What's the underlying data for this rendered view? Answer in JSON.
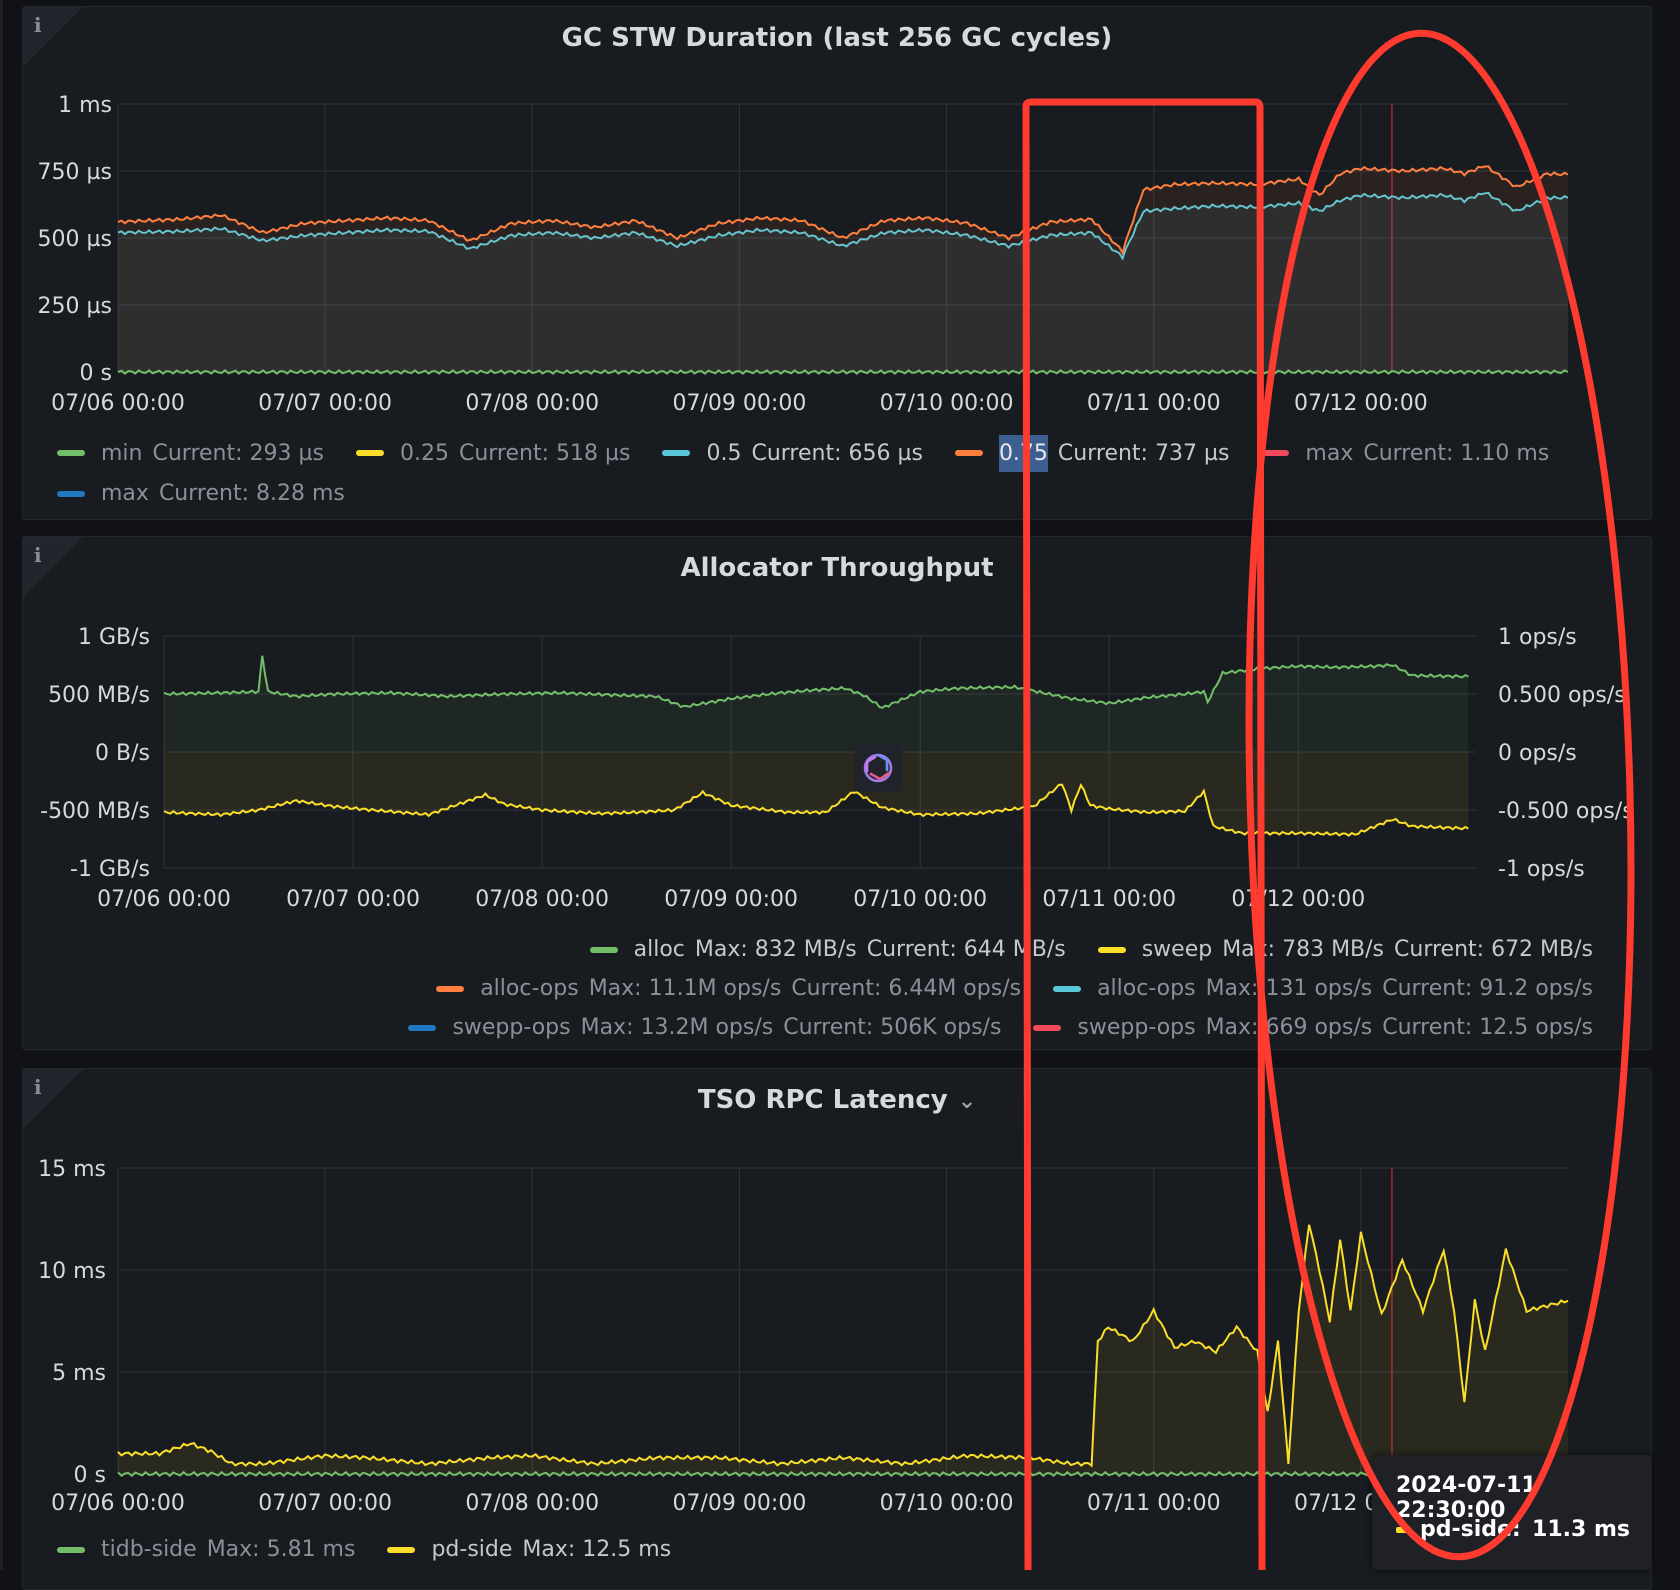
{
  "colors": {
    "green": "#73bf69",
    "yellow": "#fade2a",
    "cyan": "#5ac8d8",
    "orange": "#ff7f3e",
    "red": "#f2495c",
    "blue": "#1f78c1",
    "annotation_red": "#ff3b30"
  },
  "panels": [
    {
      "title": "GC STW Duration (last 256 GC cycles)",
      "has_dropdown": false,
      "legend": [
        [
          {
            "color": "green",
            "name": "min",
            "stats": [
              "Current: 293 µs"
            ],
            "dim": true
          },
          {
            "color": "yellow",
            "name": "0.25",
            "stats": [
              "Current: 518 µs"
            ],
            "dim": true
          },
          {
            "color": "cyan",
            "name": "0.5",
            "stats": [
              "Current: 656 µs"
            ],
            "dim": false
          },
          {
            "color": "orange",
            "name": "0.75",
            "stats": [
              "Current: 737 µs"
            ],
            "dim": false
          },
          {
            "color": "red",
            "name": "max",
            "stats": [
              "Current: 1.10 ms"
            ],
            "dim": true
          }
        ],
        [
          {
            "color": "blue",
            "name": "max",
            "stats": [
              "Current: 8.28 ms"
            ],
            "dim": true
          }
        ]
      ]
    },
    {
      "title": "Allocator Throughput",
      "has_dropdown": false,
      "legend": [
        [
          {
            "color": "green",
            "name": "alloc",
            "stats": [
              "Max: 832 MB/s",
              "Current: 644 MB/s"
            ],
            "dim": false
          },
          {
            "color": "yellow",
            "name": "sweep",
            "stats": [
              "Max: 783 MB/s",
              "Current: 672 MB/s"
            ],
            "dim": false
          }
        ],
        [
          {
            "color": "orange",
            "name": "alloc-ops",
            "stats": [
              "Max: 11.1M ops/s",
              "Current: 6.44M ops/s"
            ],
            "dim": true
          },
          {
            "color": "cyan",
            "name": "alloc-ops",
            "stats": [
              "Max: 131 ops/s",
              "Current: 91.2 ops/s"
            ],
            "dim": true
          }
        ],
        [
          {
            "color": "blue",
            "name": "swepp-ops",
            "stats": [
              "Max: 13.2M ops/s",
              "Current: 506K ops/s"
            ],
            "dim": true
          },
          {
            "color": "red",
            "name": "swepp-ops",
            "stats": [
              "Max: 669 ops/s",
              "Current: 12.5 ops/s"
            ],
            "dim": true
          }
        ]
      ]
    },
    {
      "title": "TSO RPC Latency",
      "has_dropdown": true,
      "legend": [
        [
          {
            "color": "green",
            "name": "tidb-side",
            "stats": [
              "Max: 5.81 ms"
            ],
            "dim": true
          },
          {
            "color": "yellow",
            "name": "pd-side",
            "stats": [
              "Max: 12.5 ms"
            ],
            "dim": false
          }
        ]
      ]
    }
  ],
  "tooltip": {
    "time": "2024-07-11 22:30:00",
    "series": "pd-side:",
    "value": "11.3 ms"
  },
  "chart_data": [
    {
      "type": "line",
      "title": "GC STW Duration (last 256 GC cycles)",
      "y_ticks": [
        "1 ms",
        "750 µs",
        "500 µs",
        "250 µs",
        "0 s"
      ],
      "ylim": [
        0,
        1000
      ],
      "y_unit": "µs",
      "x_ticks": [
        "07/06 00:00",
        "07/07 00:00",
        "07/08 00:00",
        "07/09 00:00",
        "07/10 00:00",
        "07/11 00:00",
        "07/12 00:00"
      ],
      "x_range": [
        "07/06 00:00",
        "07/13 00:00"
      ],
      "series": [
        {
          "name": "0.5",
          "color": "cyan",
          "x": [
            0,
            0.3,
            0.5,
            0.7,
            0.9,
            1.1,
            1.3,
            1.5,
            1.7,
            1.9,
            2.1,
            2.3,
            2.5,
            2.7,
            2.9,
            3.1,
            3.3,
            3.5,
            3.7,
            3.9,
            4.1,
            4.3,
            4.5,
            4.7,
            4.85,
            4.95,
            5.1,
            5.3,
            5.5,
            5.7,
            5.8,
            5.9,
            6.0,
            6.2,
            6.4,
            6.5,
            6.6,
            6.75,
            6.9,
            7.0
          ],
          "values": [
            520,
            525,
            535,
            490,
            510,
            520,
            530,
            525,
            460,
            510,
            520,
            500,
            520,
            470,
            510,
            530,
            520,
            470,
            520,
            530,
            510,
            470,
            510,
            520,
            430,
            600,
            610,
            620,
            615,
            630,
            600,
            640,
            660,
            650,
            660,
            640,
            670,
            600,
            650,
            650
          ]
        },
        {
          "name": "0.75",
          "color": "orange",
          "x": [
            0,
            0.3,
            0.5,
            0.7,
            0.9,
            1.1,
            1.3,
            1.5,
            1.7,
            1.9,
            2.1,
            2.3,
            2.5,
            2.7,
            2.9,
            3.1,
            3.3,
            3.5,
            3.7,
            3.9,
            4.1,
            4.3,
            4.5,
            4.7,
            4.85,
            4.95,
            5.1,
            5.3,
            5.5,
            5.7,
            5.8,
            5.9,
            6.0,
            6.2,
            6.4,
            6.5,
            6.6,
            6.75,
            6.9,
            7.0
          ],
          "values": [
            560,
            570,
            585,
            520,
            555,
            565,
            575,
            565,
            490,
            555,
            565,
            540,
            565,
            500,
            555,
            575,
            565,
            500,
            565,
            575,
            555,
            500,
            560,
            570,
            450,
            680,
            700,
            705,
            700,
            720,
            660,
            740,
            760,
            750,
            760,
            740,
            770,
            690,
            740,
            737
          ]
        },
        {
          "name": "min",
          "color": "green",
          "x": [
            0,
            7
          ],
          "values": [
            0,
            0
          ]
        }
      ]
    },
    {
      "type": "line",
      "title": "Allocator Throughput",
      "y_ticks": [
        "1 GB/s",
        "500 MB/s",
        "0 B/s",
        "-500 MB/s",
        "-1 GB/s"
      ],
      "y2_ticks": [
        "1 ops/s",
        "0.500 ops/s",
        "0 ops/s",
        "-0.500 ops/s",
        "-1 ops/s"
      ],
      "ylim": [
        -1000,
        1000
      ],
      "y_unit": "MB/s",
      "x_ticks": [
        "07/06 00:00",
        "07/07 00:00",
        "07/08 00:00",
        "07/09 00:00",
        "07/10 00:00",
        "07/11 00:00",
        "07/12 00:00"
      ],
      "x_range": [
        "07/06 00:00",
        "07/12 22:30"
      ],
      "series": [
        {
          "name": "alloc",
          "color": "green",
          "x": [
            0,
            0.3,
            0.5,
            0.52,
            0.55,
            0.7,
            0.9,
            1.2,
            1.5,
            1.8,
            2.1,
            2.4,
            2.6,
            2.75,
            3.0,
            3.2,
            3.4,
            3.6,
            3.7,
            3.8,
            4.0,
            4.2,
            4.5,
            4.8,
            5.0,
            5.2,
            5.4,
            5.5,
            5.52,
            5.6,
            5.8,
            6.0,
            6.2,
            6.4,
            6.5,
            6.6,
            6.9
          ],
          "values": [
            500,
            510,
            520,
            830,
            520,
            480,
            500,
            510,
            480,
            500,
            510,
            490,
            480,
            390,
            460,
            500,
            530,
            550,
            490,
            380,
            520,
            550,
            560,
            460,
            420,
            470,
            500,
            520,
            430,
            680,
            720,
            740,
            730,
            740,
            750,
            660,
            650
          ]
        },
        {
          "name": "sweep",
          "color": "yellow",
          "x": [
            0,
            0.3,
            0.5,
            0.7,
            0.9,
            1.1,
            1.4,
            1.7,
            1.8,
            2.0,
            2.3,
            2.5,
            2.7,
            2.85,
            3.0,
            3.3,
            3.5,
            3.65,
            3.8,
            4.0,
            4.3,
            4.6,
            4.75,
            4.8,
            4.85,
            4.9,
            5.0,
            5.2,
            5.4,
            5.5,
            5.55,
            5.7,
            6.0,
            6.3,
            6.5,
            6.6,
            6.9
          ],
          "values": [
            -520,
            -540,
            -500,
            -420,
            -470,
            -500,
            -540,
            -370,
            -450,
            -500,
            -530,
            -520,
            -500,
            -350,
            -460,
            -520,
            -520,
            -340,
            -480,
            -540,
            -530,
            -470,
            -270,
            -500,
            -280,
            -460,
            -490,
            -520,
            -510,
            -340,
            -640,
            -700,
            -700,
            -710,
            -580,
            -640,
            -660
          ]
        }
      ]
    },
    {
      "type": "line",
      "title": "TSO RPC Latency",
      "y_ticks": [
        "15 ms",
        "10 ms",
        "5 ms",
        "0 s"
      ],
      "ylim": [
        0,
        15
      ],
      "y_unit": "ms",
      "x_ticks": [
        "07/06 00:00",
        "07/07 00:00",
        "07/08 00:00",
        "07/09 00:00",
        "07/10 00:00",
        "07/11 00:00",
        "07/12 00:00"
      ],
      "x_range": [
        "07/06 00:00",
        "07/13 00:00"
      ],
      "series": [
        {
          "name": "pd-side",
          "color": "yellow",
          "x": [
            0,
            0.2,
            0.35,
            0.45,
            0.55,
            0.7,
            1.0,
            1.2,
            1.5,
            1.8,
            2.0,
            2.3,
            2.6,
            2.9,
            3.2,
            3.5,
            3.8,
            4.1,
            4.4,
            4.6,
            4.7,
            4.73,
            4.78,
            4.9,
            5.0,
            5.1,
            5.2,
            5.3,
            5.4,
            5.5,
            5.55,
            5.6,
            5.65,
            5.7,
            5.75,
            5.8,
            5.85,
            5.9,
            5.95,
            6.0,
            6.1,
            6.2,
            6.3,
            6.4,
            6.45,
            6.5,
            6.55,
            6.6,
            6.7,
            6.8,
            7.0
          ],
          "values": [
            1.0,
            1.0,
            1.5,
            1.1,
            0.5,
            0.5,
            0.9,
            0.8,
            0.5,
            0.8,
            0.9,
            0.5,
            0.8,
            0.8,
            0.5,
            0.8,
            0.5,
            0.9,
            0.8,
            0.5,
            0.5,
            6.5,
            7.2,
            6.5,
            8.0,
            6.2,
            6.5,
            6.0,
            7.2,
            6.0,
            3.0,
            6.5,
            0.5,
            8.0,
            12.3,
            10.0,
            7.5,
            11.5,
            8.0,
            11.8,
            7.8,
            10.5,
            8.0,
            11.0,
            8.0,
            3.5,
            8.5,
            6.0,
            11.0,
            8.0,
            8.5
          ]
        },
        {
          "name": "tidb-side",
          "color": "green",
          "x": [
            0,
            7
          ],
          "values": [
            0,
            0
          ]
        }
      ]
    }
  ]
}
